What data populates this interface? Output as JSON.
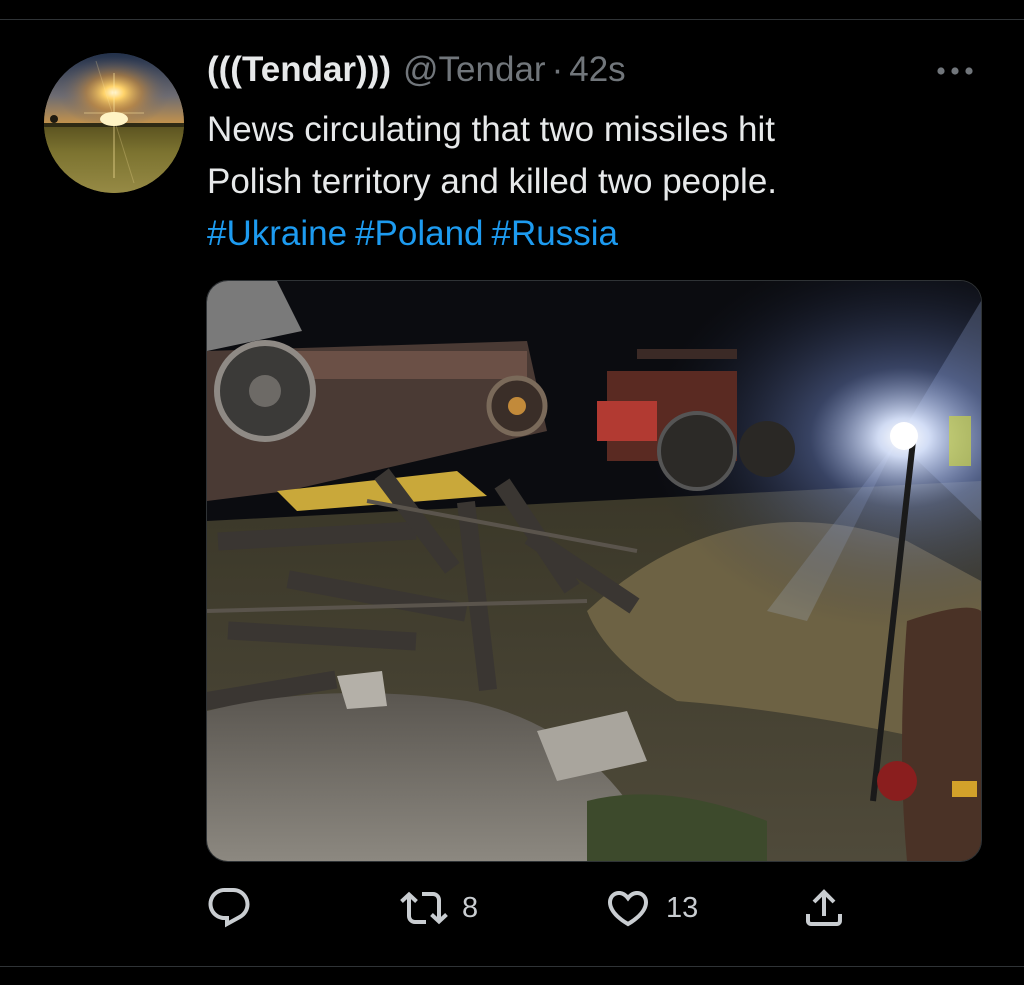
{
  "tweet": {
    "author": {
      "display_name": "(((Tendar)))",
      "handle": "@Tendar",
      "avatar": "sunset-field-avatar"
    },
    "separator": "·",
    "timestamp": "42s",
    "text_lines": [
      "News circulating that two missiles hit",
      "Polish territory and killed two people."
    ],
    "hashtags": [
      "#Ukraine",
      "#Poland",
      "#Russia"
    ],
    "media": {
      "kind": "photo",
      "description_icon": "night-debris-photo"
    },
    "actions": {
      "reply": {
        "icon": "reply-bubble-icon"
      },
      "retweet": {
        "icon": "retweet-icon",
        "count": "8"
      },
      "like": {
        "icon": "heart-icon",
        "count": "13"
      },
      "share": {
        "icon": "share-upload-icon"
      }
    },
    "more_icon": "ellipsis-icon"
  },
  "colors": {
    "background": "#000000",
    "text": "#e7e9ea",
    "muted": "#71767b",
    "link": "#1d9bf0",
    "divider": "#2f3336"
  }
}
